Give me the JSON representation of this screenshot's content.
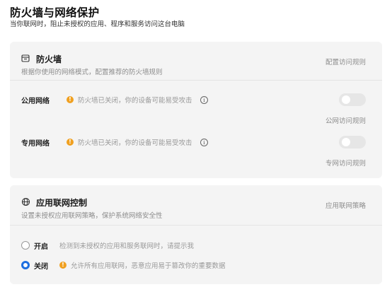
{
  "header": {
    "title": "防火墙与网络保护",
    "subtitle": "当你联网时，阻止未授权的应用、程序和服务访问这台电脑"
  },
  "firewall": {
    "icon": "firewall-shield-icon",
    "title": "防火墙",
    "description": "根据你使用的网络模式，配置推荐的防火墙规则",
    "configure_link": "配置访问规则",
    "networks": [
      {
        "label": "公用网络",
        "status": "防火墙已关闭，你的设备可能易受攻击",
        "enabled": false,
        "rules_link": "公网访问规则"
      },
      {
        "label": "专用网络",
        "status": "防火墙已关闭，你的设备可能易受攻击",
        "enabled": false,
        "rules_link": "专网访问规则"
      }
    ]
  },
  "app_control": {
    "icon": "network-globe-icon",
    "title": "应用联网控制",
    "description": "设置未授权应用联网策略，保护系统网络安全性",
    "policy_link": "应用联网策略",
    "options": [
      {
        "label": "开启",
        "description": "检测到未授权的应用和服务联网时，请提示我",
        "selected": false
      },
      {
        "label": "关闭",
        "description": "允许所有应用联网，恶意应用易于篡改你的重要数据",
        "selected": true
      }
    ]
  },
  "colors": {
    "accent": "#1e6fe0",
    "warning": "#f0a020",
    "card_bg": "#f4f4f4"
  }
}
